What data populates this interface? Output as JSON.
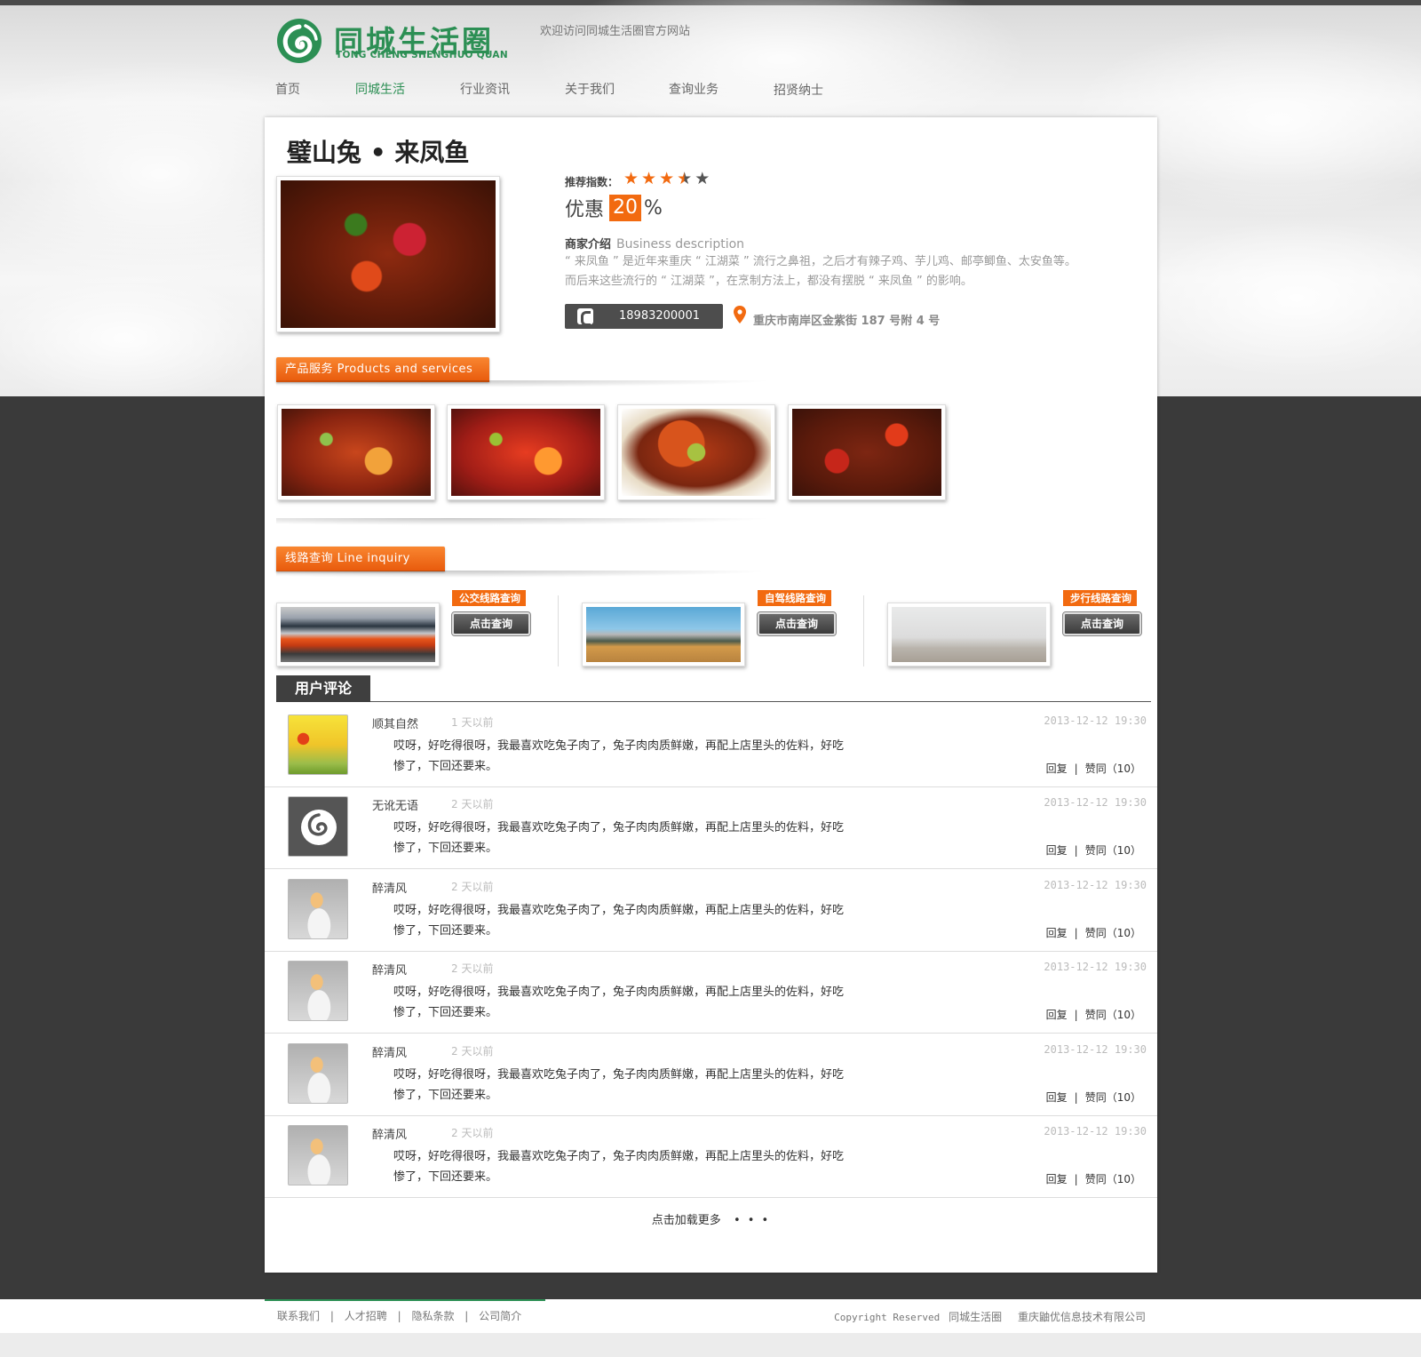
{
  "header": {
    "logo_cn": "同城生活圈",
    "logo_en": "TONG CHENG SHENGHUO QUAN",
    "welcome": "欢迎访问同城生活圈官方网站"
  },
  "nav": [
    {
      "label": "首页",
      "active": false
    },
    {
      "label": "同城生活",
      "active": true
    },
    {
      "label": "行业资讯",
      "active": false
    },
    {
      "label": "关于我们",
      "active": false
    },
    {
      "label": "查询业务",
      "active": false
    },
    {
      "label": "招贤纳士",
      "active": false
    }
  ],
  "shop": {
    "title": "璧山兔 • 来凤鱼",
    "rating_label": "推荐指数：",
    "rating": 3.5,
    "rating_max": 5,
    "discount_label": "优惠",
    "discount_value": "20",
    "discount_unit": "%",
    "desc_title_cn": "商家介绍",
    "desc_title_en": "Business description",
    "desc_line1": "“ 来凤鱼 ” 是近年来重庆 “ 江湖菜 ” 流行之鼻祖，之后才有辣子鸡、芋儿鸡、邮亭鲫鱼、太安鱼等。",
    "desc_line2": "而后来这些流行的 “ 江湖菜 ”，在烹制方法上，都没有摆脱 “ 来凤鱼 ” 的影响。",
    "phone": "18983200001",
    "address": "重庆市南岸区金紫街 187 号附 4 号"
  },
  "products": {
    "tab_label": "产品服务 Products and services"
  },
  "routes": {
    "tab_label": "线路查询 Line inquiry",
    "items": [
      {
        "tag": "公交线路查询",
        "button": "点击查询",
        "image": "bus"
      },
      {
        "tag": "自驾线路查询",
        "button": "点击查询",
        "image": "jeep"
      },
      {
        "tag": "步行线路查询",
        "button": "点击查询",
        "image": "walk"
      }
    ]
  },
  "comments": {
    "title": "用户评论",
    "load_more": "点击加载更多",
    "load_more_dots": "• • •",
    "reply_label": "回复",
    "sep": "|",
    "items": [
      {
        "name": "顺其自然",
        "ago": "1 天以前",
        "date": "2013-12-12  19:30",
        "line1": "哎呀，好吃得很呀，我最喜欢吃兔子肉了，兔子肉肉质鲜嫩，再配上店里头的佐料，好吃",
        "line2": "惨了，下回还要来。",
        "like": "赞同（10）",
        "avatar": "balloon"
      },
      {
        "name": "无讹无语",
        "ago": "2 天以前",
        "date": "2013-12-12  19:30",
        "line1": "哎呀，好吃得很呀，我最喜欢吃兔子肉了，兔子肉肉质鲜嫩，再配上店里头的佐料，好吃",
        "line2": "惨了，下回还要来。",
        "like": "赞同（10）",
        "avatar": "logo"
      },
      {
        "name": "醉清风",
        "ago": "2 天以前",
        "date": "2013-12-12  19:30",
        "line1": "哎呀，好吃得很呀，我最喜欢吃兔子肉了，兔子肉肉质鲜嫩，再配上店里头的佐料，好吃",
        "line2": "惨了，下回还要来。",
        "like": "赞同（10）",
        "avatar": "woman"
      },
      {
        "name": "醉清风",
        "ago": "2 天以前",
        "date": "2013-12-12  19:30",
        "line1": "哎呀，好吃得很呀，我最喜欢吃兔子肉了，兔子肉肉质鲜嫩，再配上店里头的佐料，好吃",
        "line2": "惨了，下回还要来。",
        "like": "赞同（10）",
        "avatar": "woman"
      },
      {
        "name": "醉清风",
        "ago": "2 天以前",
        "date": "2013-12-12  19:30",
        "line1": "哎呀，好吃得很呀，我最喜欢吃兔子肉了，兔子肉肉质鲜嫩，再配上店里头的佐料，好吃",
        "line2": "惨了，下回还要来。",
        "like": "赞同（10）",
        "avatar": "woman"
      },
      {
        "name": "醉清风",
        "ago": "2 天以前",
        "date": "2013-12-12  19:30",
        "line1": "哎呀，好吃得很呀，我最喜欢吃兔子肉了，兔子肉肉质鲜嫩，再配上店里头的佐料，好吃",
        "line2": "惨了，下回还要来。",
        "like": "赞同（10）",
        "avatar": "woman"
      }
    ]
  },
  "footer": {
    "links": [
      "联系我们",
      "人才招聘",
      "隐私条款",
      "公司简介"
    ],
    "sep": "|",
    "copyright": "Copyright Reserved",
    "site": "同城生活圈",
    "company": "重庆鼬优信息技术有限公司"
  },
  "colors": {
    "brand_green": "#2c8f54",
    "accent_orange": "#f26a10",
    "dark_band": "#3a3a3a"
  }
}
